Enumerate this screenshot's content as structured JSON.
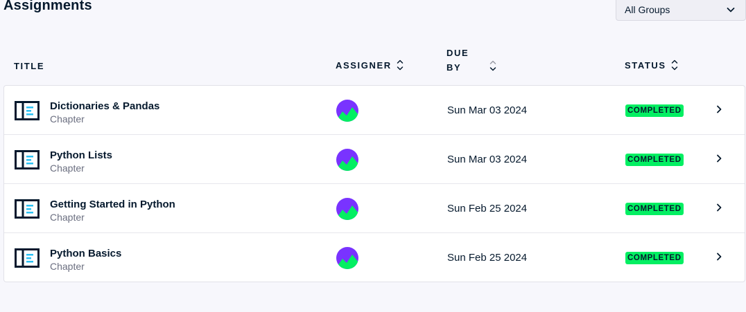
{
  "page": {
    "title": "Assignments"
  },
  "group_filter": {
    "selected": "All Groups",
    "icon": "chevron-down-icon"
  },
  "columns": {
    "title": "TITLE",
    "assigner": "ASSIGNER",
    "due_by_line1": "DUE",
    "due_by_line2": "BY",
    "status": "STATUS"
  },
  "rows": [
    {
      "title": "Dictionaries & Pandas",
      "type": "Chapter",
      "due": "Sun Mar 03 2024",
      "status": "COMPLETED"
    },
    {
      "title": "Python Lists",
      "type": "Chapter",
      "due": "Sun Mar 03 2024",
      "status": "COMPLETED"
    },
    {
      "title": "Getting Started in Python",
      "type": "Chapter",
      "due": "Sun Feb 25 2024",
      "status": "COMPLETED"
    },
    {
      "title": "Python Basics",
      "type": "Chapter",
      "due": "Sun Feb 25 2024",
      "status": "COMPLETED"
    }
  ],
  "colors": {
    "status_completed": "#03ef62",
    "icon_accent": "#2bc2f5",
    "avatar_purple": "#7933ff",
    "avatar_green": "#03ef62",
    "text_dark": "#05192d"
  }
}
